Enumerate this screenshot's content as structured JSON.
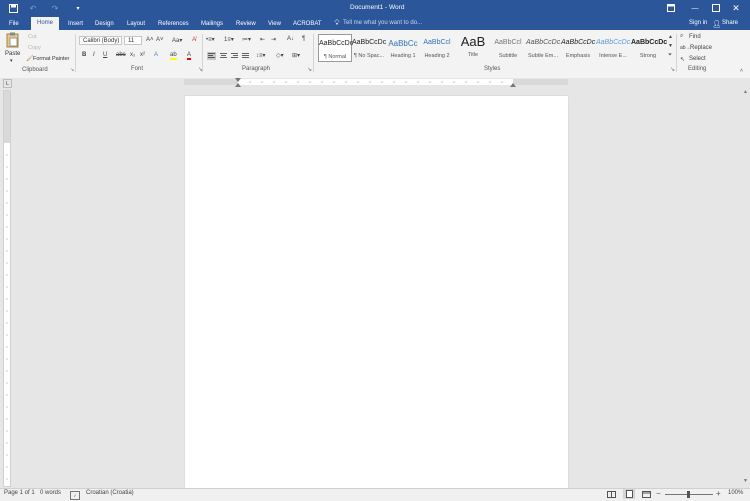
{
  "window": {
    "title": "Document1 - Word"
  },
  "tabs": [
    "File",
    "Home",
    "Insert",
    "Design",
    "Layout",
    "References",
    "Mailings",
    "Review",
    "View",
    "ACROBAT"
  ],
  "tell_me": "Tell me what you want to do...",
  "account": {
    "sign_in": "Sign in",
    "share": "Share"
  },
  "clipboard": {
    "paste": "Paste",
    "cut": "Cut",
    "copy": "Copy",
    "format_painter": "Format Painter",
    "group": "Clipboard"
  },
  "font": {
    "family": "Calibri (Body)",
    "size": "11",
    "group": "Font"
  },
  "paragraph": {
    "group": "Paragraph"
  },
  "styles": {
    "group": "Styles",
    "items": [
      {
        "sample": "AaBbCcDc",
        "name": "¶ Normal"
      },
      {
        "sample": "AaBbCcDc",
        "name": "¶ No Spac..."
      },
      {
        "sample": "AaBbCc",
        "name": "Heading 1"
      },
      {
        "sample": "AaBbCcl",
        "name": "Heading 2"
      },
      {
        "sample": "AaB",
        "name": "Title"
      },
      {
        "sample": "AaBbCcl",
        "name": "Subtitle"
      },
      {
        "sample": "AaBbCcDc",
        "name": "Subtle Em..."
      },
      {
        "sample": "AaBbCcDc",
        "name": "Emphasis"
      },
      {
        "sample": "AaBbCcDc",
        "name": "Intense E..."
      },
      {
        "sample": "AaBbCcDc",
        "name": "Strong"
      }
    ]
  },
  "editing": {
    "find": "Find",
    "replace": "Replace",
    "select": "Select",
    "group": "Editing"
  },
  "status": {
    "page": "Page 1 of 1",
    "words": "0 words",
    "language": "Croatian (Croatia)",
    "zoom": "100%"
  },
  "colors": {
    "brand": "#2b579a",
    "ribbon_bg": "#f3f3f3",
    "canvas": "#e6e6e6"
  }
}
